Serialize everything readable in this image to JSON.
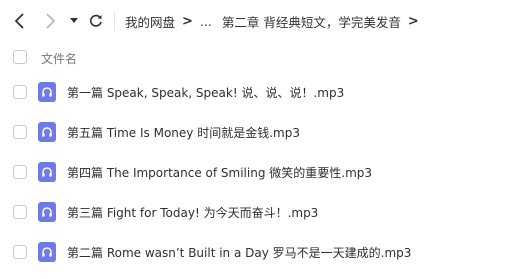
{
  "nav": {
    "back_icon": "chevron-left-icon",
    "forward_icon": "chevron-right-icon",
    "dropdown_icon": "caret-down-icon",
    "refresh_icon": "refresh-icon"
  },
  "breadcrumb": {
    "items": [
      "我的网盘",
      "...",
      "第二章 背经典短文，学完美发音"
    ],
    "separator": ">"
  },
  "list": {
    "column_header": "文件名",
    "files": [
      {
        "name": "第一篇 Speak, Speak, Speak! 说、说、说！.mp3",
        "icon": "audio-file-icon"
      },
      {
        "name": "第五篇 Time Is Money 时间就是金钱.mp3",
        "icon": "audio-file-icon"
      },
      {
        "name": "第四篇 The Importance of Smiling 微笑的重要性.mp3",
        "icon": "audio-file-icon"
      },
      {
        "name": "第三篇 Fight for Today! 为今天而奋斗！.mp3",
        "icon": "audio-file-icon"
      },
      {
        "name": "第二篇 Rome wasn’t Built in a Day 罗马不是一天建成的.mp3",
        "icon": "audio-file-icon"
      }
    ]
  },
  "colors": {
    "audio_icon": "#6f7ae8",
    "disabled": "#b8b8b8",
    "checkbox_border": "#c9c9c9"
  }
}
